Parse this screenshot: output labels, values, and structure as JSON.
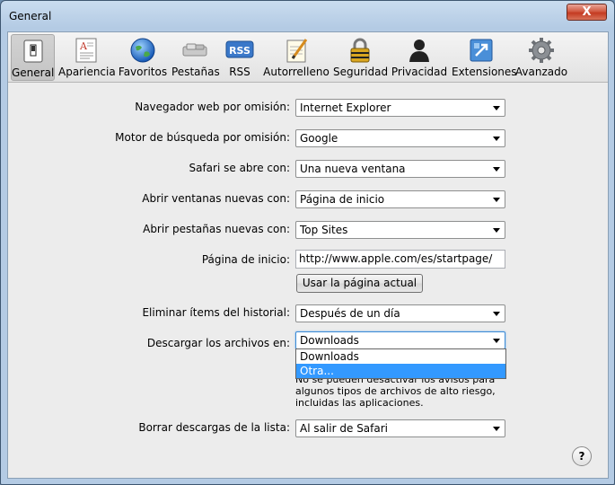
{
  "window": {
    "title": "General",
    "close_glyph": "X"
  },
  "toolbar": {
    "items": [
      {
        "label": "General",
        "icon": "switch-icon",
        "selected": true
      },
      {
        "label": "Apariencia",
        "icon": "appearance-icon"
      },
      {
        "label": "Favoritos",
        "icon": "globe-icon"
      },
      {
        "label": "Pestañas",
        "icon": "tabs-icon"
      },
      {
        "label": "RSS",
        "icon": "rss-icon",
        "icon_text": "RSS"
      },
      {
        "label": "Autorrelleno",
        "icon": "pencil-paper-icon"
      },
      {
        "label": "Seguridad",
        "icon": "padlock-icon"
      },
      {
        "label": "Privacidad",
        "icon": "silhouette-icon"
      },
      {
        "label": "Extensiones",
        "icon": "extensions-icon"
      },
      {
        "label": "Avanzado",
        "icon": "gear-icon"
      }
    ]
  },
  "form": {
    "default_browser": {
      "label": "Navegador web por omisión:",
      "value": "Internet Explorer"
    },
    "search_engine": {
      "label": "Motor de búsqueda por omisión:",
      "value": "Google"
    },
    "safari_opens": {
      "label": "Safari se abre con:",
      "value": "Una nueva ventana"
    },
    "new_windows": {
      "label": "Abrir ventanas nuevas con:",
      "value": "Página de inicio"
    },
    "new_tabs": {
      "label": "Abrir pestañas nuevas con:",
      "value": "Top Sites"
    },
    "homepage": {
      "label": "Página de inicio:",
      "value": "http://www.apple.com/es/startpage/"
    },
    "use_current_page": {
      "label": "Usar la página actual"
    },
    "remove_history": {
      "label": "Eliminar ítems del historial:",
      "value": "Después de un día"
    },
    "save_downloads": {
      "label": "Descargar los archivos en:",
      "value": "Downloads",
      "options": [
        "Downloads",
        "Otra..."
      ],
      "highlighted_option": "Otra..."
    },
    "warning_note": "No se pueden desactivar los avisos para algunos tipos de archivos de alto riesgo, incluidas las aplicaciones.",
    "clear_downloads": {
      "label": "Borrar descargas de la lista:",
      "value": "Al salir de Safari"
    }
  },
  "help": {
    "glyph": "?"
  },
  "colors": {
    "highlight": "#3399ff",
    "titlebar": "#b4cbe4",
    "close": "#c43b21"
  }
}
